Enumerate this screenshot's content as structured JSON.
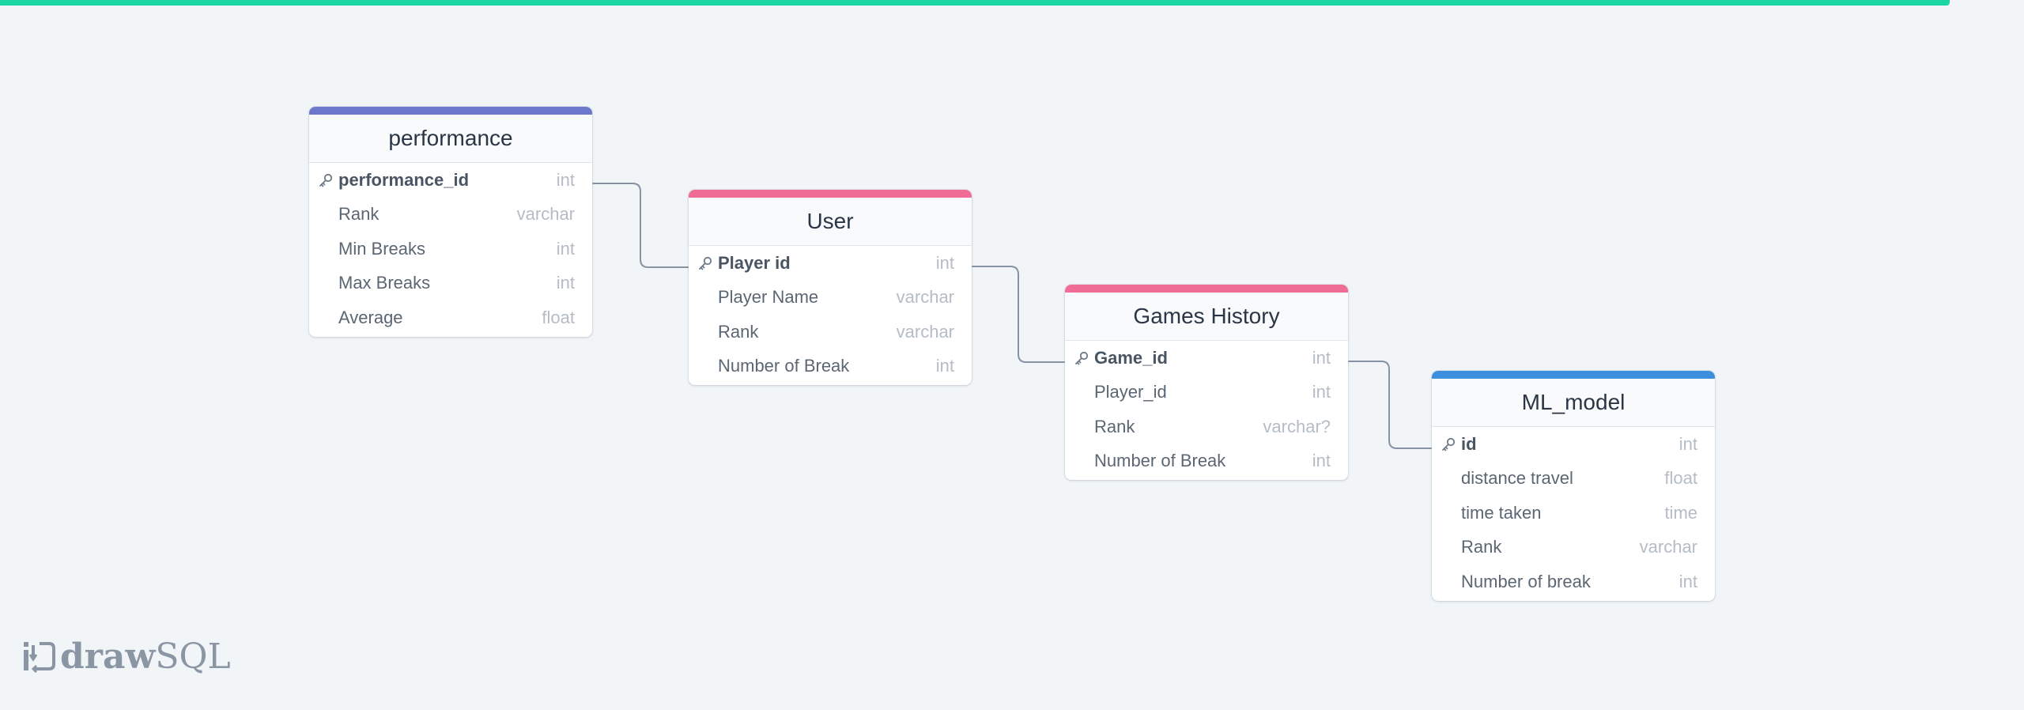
{
  "colors": {
    "background": "#f1f5f8",
    "top_bar": "#1bd5a2",
    "connector": "#8593a3"
  },
  "logo": {
    "part1": "draw",
    "part2": "SQL",
    "icon": "drawsql-logo-icon"
  },
  "tables": [
    {
      "id": "performance",
      "title": "performance",
      "accent": "#6b78cc",
      "rows": [
        {
          "name": "performance_id",
          "type": "int",
          "pk": true
        },
        {
          "name": "Rank",
          "type": "varchar",
          "pk": false
        },
        {
          "name": "Min Breaks",
          "type": "int",
          "pk": false
        },
        {
          "name": "Max Breaks",
          "type": "int",
          "pk": false
        },
        {
          "name": "Average",
          "type": "float",
          "pk": false
        }
      ]
    },
    {
      "id": "user",
      "title": "User",
      "accent": "#ef6c94",
      "rows": [
        {
          "name": "Player id",
          "type": "int",
          "pk": true
        },
        {
          "name": "Player Name",
          "type": "varchar",
          "pk": false
        },
        {
          "name": "Rank",
          "type": "varchar",
          "pk": false
        },
        {
          "name": "Number of Break",
          "type": "int",
          "pk": false
        }
      ]
    },
    {
      "id": "games-history",
      "title": "Games History",
      "accent": "#ef6c94",
      "rows": [
        {
          "name": "Game_id",
          "type": "int",
          "pk": true
        },
        {
          "name": "Player_id",
          "type": "int",
          "pk": false
        },
        {
          "name": "Rank",
          "type": "varchar?",
          "pk": false
        },
        {
          "name": "Number of Break",
          "type": "int",
          "pk": false
        }
      ]
    },
    {
      "id": "ml-model",
      "title": "ML_model",
      "accent": "#3b8fdc",
      "rows": [
        {
          "name": "id",
          "type": "int",
          "pk": true
        },
        {
          "name": "distance travel",
          "type": "float",
          "pk": false
        },
        {
          "name": "time taken",
          "type": "time",
          "pk": false
        },
        {
          "name": "Rank",
          "type": "varchar",
          "pk": false
        },
        {
          "name": "Number of break",
          "type": "int",
          "pk": false
        }
      ]
    }
  ]
}
